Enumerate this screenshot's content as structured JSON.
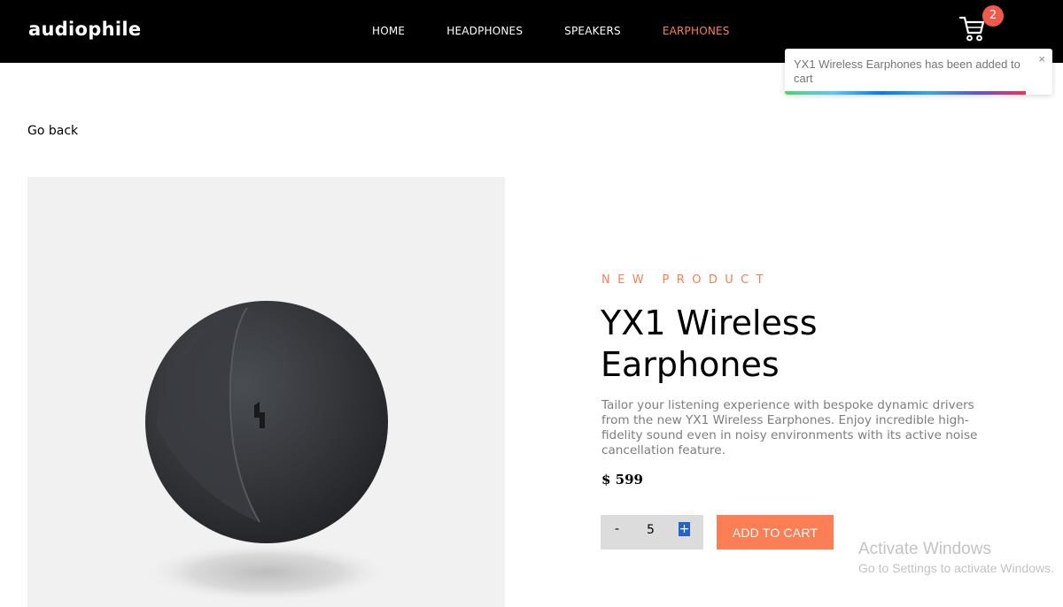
{
  "header": {
    "logo": "audiophile",
    "nav": [
      {
        "label": "HOME",
        "active": false
      },
      {
        "label": "HEADPHONES",
        "active": false
      },
      {
        "label": "SPEAKERS",
        "active": false
      },
      {
        "label": "EARPHONES",
        "active": true
      }
    ],
    "cart_icon": "cart-icon",
    "cart_count": "2"
  },
  "toast": {
    "message": "YX1 Wireless Earphones has been added to cart",
    "close": "×",
    "progress": 0.9
  },
  "go_back": "Go back",
  "product": {
    "image_icon": "earphone-image",
    "overline": "NEW PRODUCT",
    "title": "YX1 Wireless Earphones",
    "description": "Tailor your listening experience with bespoke dynamic drivers from the new YX1 Wireless Earphones. Enjoy incredible high-fidelity sound even in noisy environments with its active noise cancellation feature.",
    "price": "$ 599"
  },
  "quantity": {
    "minus": "-",
    "value": "5",
    "plus": "+"
  },
  "add_to_cart": "ADD TO CART",
  "watermark": {
    "title": "Activate Windows",
    "subtitle": "Go to Settings to activate Windows."
  },
  "colors": {
    "accent": "#fb7e55",
    "header_bg": "#000000",
    "badge": "#f15a4a",
    "image_bg": "#f1f1f1"
  }
}
